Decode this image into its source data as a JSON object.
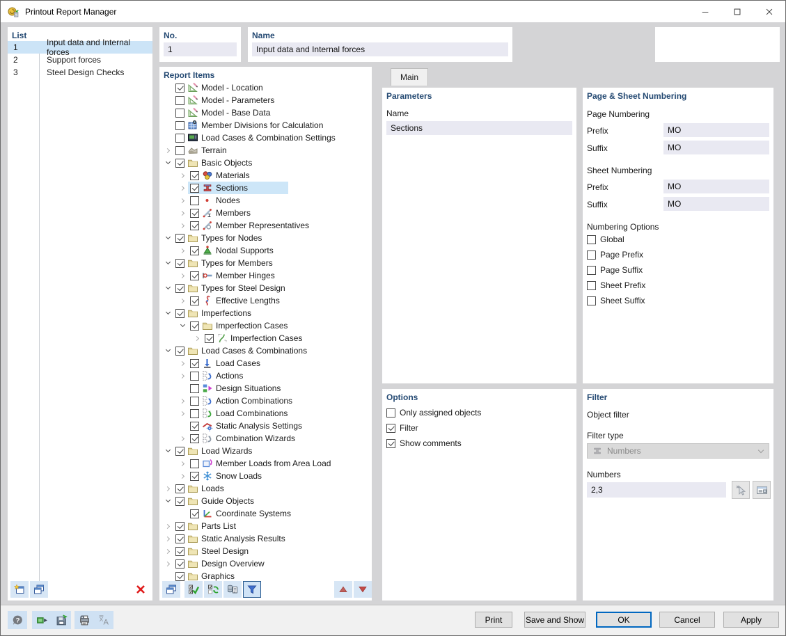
{
  "window": {
    "title": "Printout Report Manager"
  },
  "list_panel": {
    "header": "List",
    "items": [
      {
        "no": "1",
        "name": "Input data and Internal forces",
        "selected": true
      },
      {
        "no": "2",
        "name": "Support forces",
        "selected": false
      },
      {
        "no": "3",
        "name": "Steel Design Checks",
        "selected": false
      }
    ],
    "toolbar": [
      "new-report",
      "copy-report"
    ],
    "delete_icon": "delete-report"
  },
  "no_panel": {
    "label": "No.",
    "value": "1"
  },
  "name_panel": {
    "label": "Name",
    "value": "Input data and Internal forces"
  },
  "tabs": [
    {
      "label": "Main",
      "active": true
    }
  ],
  "report_items": {
    "header": "Report Items",
    "toolbar": [
      {
        "icon": "cascade-windows",
        "active": false
      },
      {
        "icon": "check-all",
        "active": false
      },
      {
        "icon": "toggle-checks",
        "active": false
      },
      {
        "icon": "copy-items",
        "active": false
      },
      {
        "icon": "filter",
        "active": true
      }
    ],
    "move_buttons": [
      {
        "icon": "arrow-up"
      },
      {
        "icon": "arrow-down"
      }
    ],
    "tree": [
      {
        "label": "Model - Location",
        "level": 0,
        "expander": "none",
        "checked": true,
        "icon": "model"
      },
      {
        "label": "Model - Parameters",
        "level": 0,
        "expander": "none",
        "checked": false,
        "icon": "model"
      },
      {
        "label": "Model - Base Data",
        "level": 0,
        "expander": "none",
        "checked": false,
        "icon": "model"
      },
      {
        "label": "Member Divisions for Calculation",
        "level": 0,
        "expander": "none",
        "checked": false,
        "icon": "calc-grid"
      },
      {
        "label": "Load Cases & Combination Settings",
        "level": 0,
        "expander": "none",
        "checked": false,
        "icon": "lc-settings"
      },
      {
        "label": "Terrain",
        "level": 0,
        "expander": "collapsed",
        "checked": false,
        "icon": "terrain"
      },
      {
        "label": "Basic Objects",
        "level": 0,
        "expander": "expanded",
        "checked": true,
        "icon": "folder"
      },
      {
        "label": "Materials",
        "level": 1,
        "expander": "collapsed",
        "checked": true,
        "icon": "materials"
      },
      {
        "label": "Sections",
        "level": 1,
        "expander": "collapsed",
        "checked": true,
        "icon": "sections",
        "selected": true
      },
      {
        "label": "Nodes",
        "level": 1,
        "expander": "collapsed",
        "checked": false,
        "icon": "node"
      },
      {
        "label": "Members",
        "level": 1,
        "expander": "collapsed",
        "checked": true,
        "icon": "member"
      },
      {
        "label": "Member Representatives",
        "level": 1,
        "expander": "collapsed",
        "checked": true,
        "icon": "member-rep"
      },
      {
        "label": "Types for Nodes",
        "level": 0,
        "expander": "expanded",
        "checked": true,
        "icon": "folder"
      },
      {
        "label": "Nodal Supports",
        "level": 1,
        "expander": "collapsed",
        "checked": true,
        "icon": "nodal-support"
      },
      {
        "label": "Types for Members",
        "level": 0,
        "expander": "expanded",
        "checked": true,
        "icon": "folder"
      },
      {
        "label": "Member Hinges",
        "level": 1,
        "expander": "collapsed",
        "checked": true,
        "icon": "member-hinge"
      },
      {
        "label": "Types for Steel Design",
        "level": 0,
        "expander": "expanded",
        "checked": true,
        "icon": "folder"
      },
      {
        "label": "Effective Lengths",
        "level": 1,
        "expander": "collapsed",
        "checked": true,
        "icon": "effective-length"
      },
      {
        "label": "Imperfections",
        "level": 0,
        "expander": "expanded",
        "checked": true,
        "icon": "folder"
      },
      {
        "label": "Imperfection Cases",
        "level": 1,
        "expander": "expanded",
        "checked": true,
        "icon": "folder"
      },
      {
        "label": "Imperfection Cases",
        "level": 2,
        "expander": "collapsed",
        "checked": true,
        "icon": "imperfection"
      },
      {
        "label": "Load Cases & Combinations",
        "level": 0,
        "expander": "expanded",
        "checked": true,
        "icon": "folder"
      },
      {
        "label": "Load Cases",
        "level": 1,
        "expander": "collapsed",
        "checked": true,
        "icon": "load-case"
      },
      {
        "label": "Actions",
        "level": 1,
        "expander": "collapsed",
        "checked": false,
        "icon": "actions"
      },
      {
        "label": "Design Situations",
        "level": 1,
        "expander": "none",
        "checked": false,
        "icon": "design-situation"
      },
      {
        "label": "Action Combinations",
        "level": 1,
        "expander": "collapsed",
        "checked": false,
        "icon": "action-comb"
      },
      {
        "label": "Load Combinations",
        "level": 1,
        "expander": "collapsed",
        "checked": false,
        "icon": "load-comb"
      },
      {
        "label": "Static Analysis Settings",
        "level": 1,
        "expander": "none",
        "checked": true,
        "icon": "static-analysis"
      },
      {
        "label": "Combination Wizards",
        "level": 1,
        "expander": "collapsed",
        "checked": true,
        "icon": "comb-wizard"
      },
      {
        "label": "Load Wizards",
        "level": 0,
        "expander": "expanded",
        "checked": true,
        "icon": "folder"
      },
      {
        "label": "Member Loads from Area Load",
        "level": 1,
        "expander": "collapsed",
        "checked": false,
        "icon": "area-load"
      },
      {
        "label": "Snow Loads",
        "level": 1,
        "expander": "collapsed",
        "checked": true,
        "icon": "snow"
      },
      {
        "label": "Loads",
        "level": 0,
        "expander": "collapsed",
        "checked": true,
        "icon": "folder"
      },
      {
        "label": "Guide Objects",
        "level": 0,
        "expander": "expanded",
        "checked": true,
        "icon": "folder"
      },
      {
        "label": "Coordinate Systems",
        "level": 1,
        "expander": "none",
        "checked": true,
        "icon": "coord-system"
      },
      {
        "label": "Parts List",
        "level": 0,
        "expander": "collapsed",
        "checked": true,
        "icon": "folder"
      },
      {
        "label": "Static Analysis Results",
        "level": 0,
        "expander": "collapsed",
        "checked": true,
        "icon": "folder"
      },
      {
        "label": "Steel Design",
        "level": 0,
        "expander": "collapsed",
        "checked": true,
        "icon": "folder"
      },
      {
        "label": "Design Overview",
        "level": 0,
        "expander": "collapsed",
        "checked": true,
        "icon": "folder"
      },
      {
        "label": "Graphics",
        "level": 0,
        "expander": "none",
        "checked": true,
        "icon": "folder"
      }
    ]
  },
  "parameters": {
    "header": "Parameters",
    "name_label": "Name",
    "name_value": "Sections"
  },
  "page_sheet": {
    "header": "Page & Sheet Numbering",
    "page_numbering_label": "Page Numbering",
    "sheet_numbering_label": "Sheet Numbering",
    "prefix_label": "Prefix",
    "suffix_label": "Suffix",
    "page_prefix": "MO",
    "page_suffix": "MO",
    "sheet_prefix": "MO",
    "sheet_suffix": "MO",
    "numbering_options_label": "Numbering Options",
    "numbering_options": [
      {
        "label": "Global",
        "checked": false
      },
      {
        "label": "Page Prefix",
        "checked": false
      },
      {
        "label": "Page Suffix",
        "checked": false
      },
      {
        "label": "Sheet Prefix",
        "checked": false
      },
      {
        "label": "Sheet Suffix",
        "checked": false
      }
    ]
  },
  "options_panel": {
    "header": "Options",
    "checkboxes": [
      {
        "label": "Only assigned objects",
        "checked": false
      },
      {
        "label": "Filter",
        "checked": true
      },
      {
        "label": "Show comments",
        "checked": true
      }
    ]
  },
  "filter_panel": {
    "header": "Filter",
    "object_filter_label": "Object filter",
    "filter_type_label": "Filter type",
    "filter_type_value": "Numbers",
    "filter_type_icon": "combo-section",
    "numbers_label": "Numbers",
    "numbers_value": "2,3",
    "buttons": [
      "pick",
      "list-edit"
    ]
  },
  "footer": {
    "icon_buttons": [
      "help",
      "open-config",
      "save-config",
      "print-settings",
      "language"
    ],
    "buttons": [
      {
        "label": "Print",
        "default": false
      },
      {
        "label": "Save and Show",
        "default": false
      },
      {
        "label": "OK",
        "default": true
      },
      {
        "label": "Cancel",
        "default": false
      },
      {
        "label": "Apply",
        "default": false
      }
    ]
  },
  "colors": {
    "accent": "#0067c0",
    "selection": "#cce4f7",
    "header_text": "#254a73",
    "field_bg": "#e9e9f2",
    "toolbar_button_bg": "#d7e6f5"
  }
}
